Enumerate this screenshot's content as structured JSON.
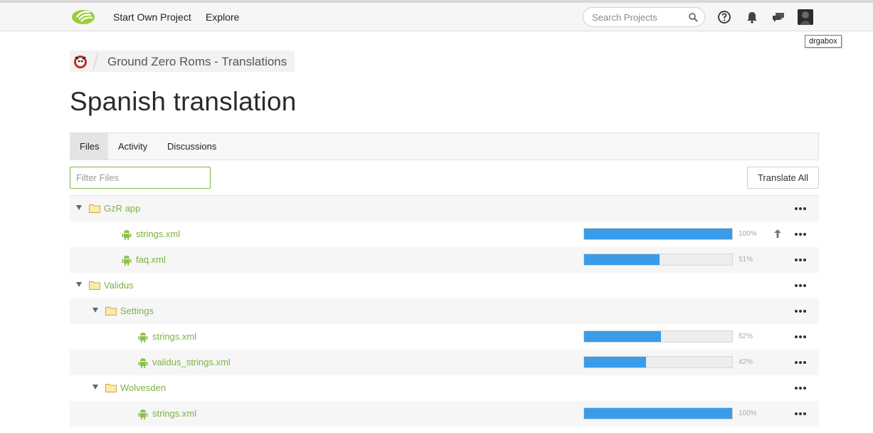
{
  "nav": {
    "start_project": "Start Own Project",
    "explore": "Explore",
    "search_placeholder": "Search Projects",
    "user_tooltip": "drgabox",
    "icons": [
      "help-icon",
      "bell-icon",
      "chat-icon"
    ]
  },
  "breadcrumb": {
    "project": "Ground Zero Roms - Translations"
  },
  "page": {
    "title": "Spanish translation"
  },
  "tabs": [
    {
      "label": "Files",
      "active": true
    },
    {
      "label": "Activity",
      "active": false
    },
    {
      "label": "Discussions",
      "active": false
    }
  ],
  "toolbar": {
    "filter_placeholder": "Filter Files",
    "translate_all": "Translate All"
  },
  "colors": {
    "accent": "#7cb342",
    "progress": "#3a9ce9"
  },
  "tree": [
    {
      "type": "folder",
      "name": "GzR app",
      "depth": 0
    },
    {
      "type": "file",
      "name": "strings.xml",
      "depth": 1,
      "progress": 100,
      "pct_label": "100%",
      "upload": true
    },
    {
      "type": "file",
      "name": "faq.xml",
      "depth": 1,
      "progress": 51,
      "pct_label": "51%"
    },
    {
      "type": "folder",
      "name": "Validus",
      "depth": 0
    },
    {
      "type": "folder",
      "name": "Settings",
      "depth": 1
    },
    {
      "type": "file",
      "name": "strings.xml",
      "depth": 2,
      "progress": 52,
      "pct_label": "52%"
    },
    {
      "type": "file",
      "name": "validus_strings.xml",
      "depth": 2,
      "progress": 42,
      "pct_label": "42%"
    },
    {
      "type": "folder",
      "name": "Wolvesden",
      "depth": 1
    },
    {
      "type": "file",
      "name": "strings.xml",
      "depth": 2,
      "progress": 100,
      "pct_label": "100%"
    }
  ]
}
